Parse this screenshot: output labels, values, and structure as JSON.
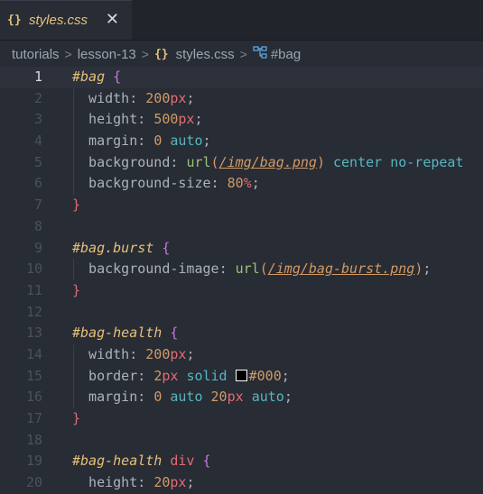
{
  "tab": {
    "icon": "css-braces-icon",
    "icon_text": "{}",
    "label": "styles.css",
    "close": "✕"
  },
  "breadcrumb": {
    "items": [
      "tutorials",
      "lesson-13"
    ],
    "file_icon_text": "{}",
    "file": "styles.css",
    "symbol": "#bag",
    "separator": ">"
  },
  "editor": {
    "current_line": 1,
    "lines": [
      {
        "n": "1"
      },
      {
        "n": "2"
      },
      {
        "n": "3"
      },
      {
        "n": "4"
      },
      {
        "n": "5"
      },
      {
        "n": "6"
      },
      {
        "n": "7"
      },
      {
        "n": "8"
      },
      {
        "n": "9"
      },
      {
        "n": "10"
      },
      {
        "n": "11"
      },
      {
        "n": "12"
      },
      {
        "n": "13"
      },
      {
        "n": "14"
      },
      {
        "n": "15"
      },
      {
        "n": "16"
      },
      {
        "n": "17"
      },
      {
        "n": "18"
      },
      {
        "n": "19"
      },
      {
        "n": "20"
      }
    ],
    "tokens": {
      "l1": [
        [
          "sel",
          "#bag"
        ],
        [
          "punc",
          " "
        ],
        [
          "brace-open",
          "{"
        ]
      ],
      "l2": [
        [
          "prop",
          "  width"
        ],
        [
          "punc",
          ": "
        ],
        [
          "num",
          "200"
        ],
        [
          "unit",
          "px"
        ],
        [
          "punc",
          ";"
        ]
      ],
      "l3": [
        [
          "prop",
          "  height"
        ],
        [
          "punc",
          ": "
        ],
        [
          "num",
          "500"
        ],
        [
          "unit",
          "px"
        ],
        [
          "punc",
          ";"
        ]
      ],
      "l4": [
        [
          "prop",
          "  margin"
        ],
        [
          "punc",
          ": "
        ],
        [
          "num",
          "0"
        ],
        [
          "punc",
          " "
        ],
        [
          "kw",
          "auto"
        ],
        [
          "punc",
          ";"
        ]
      ],
      "l5": [
        [
          "prop",
          "  background"
        ],
        [
          "punc",
          ": "
        ],
        [
          "fn",
          "url"
        ],
        [
          "paren",
          "("
        ],
        [
          "url",
          "/img/bag.png"
        ],
        [
          "paren",
          ")"
        ],
        [
          "punc",
          " "
        ],
        [
          "kw",
          "center"
        ],
        [
          "punc",
          " "
        ],
        [
          "kw",
          "no-repeat"
        ]
      ],
      "l6": [
        [
          "prop",
          "  background-size"
        ],
        [
          "punc",
          ": "
        ],
        [
          "num",
          "80"
        ],
        [
          "unit",
          "%"
        ],
        [
          "punc",
          ";"
        ]
      ],
      "l7": [
        [
          "brace-red",
          "}"
        ]
      ],
      "l8": [],
      "l9": [
        [
          "sel",
          "#bag"
        ],
        [
          "cls",
          ".burst"
        ],
        [
          "punc",
          " "
        ],
        [
          "brace-open",
          "{"
        ]
      ],
      "l10": [
        [
          "prop",
          "  background-image"
        ],
        [
          "punc",
          ": "
        ],
        [
          "fn",
          "url"
        ],
        [
          "paren",
          "("
        ],
        [
          "url",
          "/img/bag-burst.png"
        ],
        [
          "paren",
          ")"
        ],
        [
          "punc",
          ";"
        ]
      ],
      "l11": [
        [
          "brace-red",
          "}"
        ]
      ],
      "l12": [],
      "l13": [
        [
          "sel",
          "#bag-health"
        ],
        [
          "punc",
          " "
        ],
        [
          "brace-open",
          "{"
        ]
      ],
      "l14": [
        [
          "prop",
          "  width"
        ],
        [
          "punc",
          ": "
        ],
        [
          "num",
          "200"
        ],
        [
          "unit",
          "px"
        ],
        [
          "punc",
          ";"
        ]
      ],
      "l15": [
        [
          "prop",
          "  border"
        ],
        [
          "punc",
          ": "
        ],
        [
          "num",
          "2"
        ],
        [
          "unit",
          "px"
        ],
        [
          "punc",
          " "
        ],
        [
          "kw",
          "solid"
        ],
        [
          "punc",
          " "
        ],
        [
          "swatch",
          ""
        ],
        [
          "hex",
          "#000"
        ],
        [
          "punc",
          ";"
        ]
      ],
      "l16": [
        [
          "prop",
          "  margin"
        ],
        [
          "punc",
          ": "
        ],
        [
          "num",
          "0"
        ],
        [
          "punc",
          " "
        ],
        [
          "kw",
          "auto"
        ],
        [
          "punc",
          " "
        ],
        [
          "num",
          "20"
        ],
        [
          "unit",
          "px"
        ],
        [
          "punc",
          " "
        ],
        [
          "kw",
          "auto"
        ],
        [
          "punc",
          ";"
        ]
      ],
      "l17": [
        [
          "brace-red",
          "}"
        ]
      ],
      "l18": [],
      "l19": [
        [
          "sel",
          "#bag-health"
        ],
        [
          "punc",
          " "
        ],
        [
          "tag",
          "div"
        ],
        [
          "punc",
          " "
        ],
        [
          "brace-open",
          "{"
        ]
      ],
      "l20": [
        [
          "prop",
          "  height"
        ],
        [
          "punc",
          ": "
        ],
        [
          "num",
          "20"
        ],
        [
          "unit",
          "px"
        ],
        [
          "punc",
          ";"
        ]
      ]
    }
  },
  "colors": {
    "editor_bg": "#282c34",
    "selector": "#e5c07b",
    "number": "#d19a66",
    "unit": "#e06c75",
    "keyword": "#56b6c2",
    "function": "#98c379",
    "brace": "#c678dd"
  }
}
